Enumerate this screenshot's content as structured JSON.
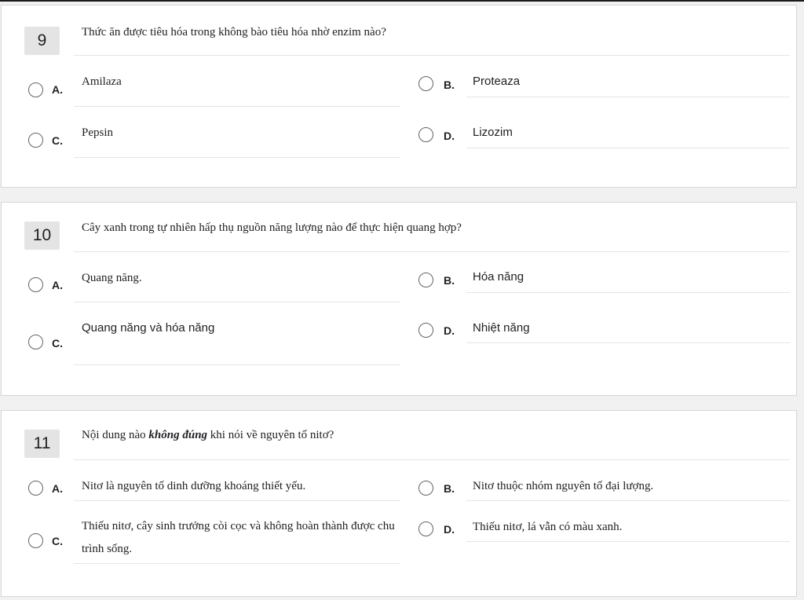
{
  "questions": [
    {
      "number": "9",
      "text": "Thức ăn được tiêu hóa trong không bào tiêu hóa nhờ enzim nào?",
      "options": [
        {
          "letter": "A.",
          "text": "Amilaza"
        },
        {
          "letter": "B.",
          "text": "Proteaza"
        },
        {
          "letter": "C.",
          "text": "Pepsin"
        },
        {
          "letter": "D.",
          "text": "Lizozim"
        }
      ]
    },
    {
      "number": "10",
      "text": "Cây xanh trong tự nhiên hấp thụ nguồn năng lượng nào để thực hiện quang hợp?",
      "options": [
        {
          "letter": "A.",
          "text": "Quang năng."
        },
        {
          "letter": "B.",
          "text": "Hóa năng"
        },
        {
          "letter": "C.",
          "text": "Quang năng và hóa năng"
        },
        {
          "letter": "D.",
          "text": "Nhiệt năng"
        }
      ]
    },
    {
      "number": "11",
      "text_before": "Nội dung nào ",
      "text_emphasis": "không đúng",
      "text_after": " khi nói về nguyên tố nitơ?",
      "options": [
        {
          "letter": "A.",
          "text": "Nitơ là nguyên tố dinh dưỡng khoáng thiết yếu."
        },
        {
          "letter": "B.",
          "text": "Nitơ thuộc nhóm nguyên tố đại lượng."
        },
        {
          "letter": "C.",
          "text": "Thiếu nitơ, cây sinh trưởng còi cọc và không hoàn thành được chu trình sống."
        },
        {
          "letter": "D.",
          "text": "Thiếu nitơ, lá vẫn có màu xanh."
        }
      ]
    }
  ]
}
